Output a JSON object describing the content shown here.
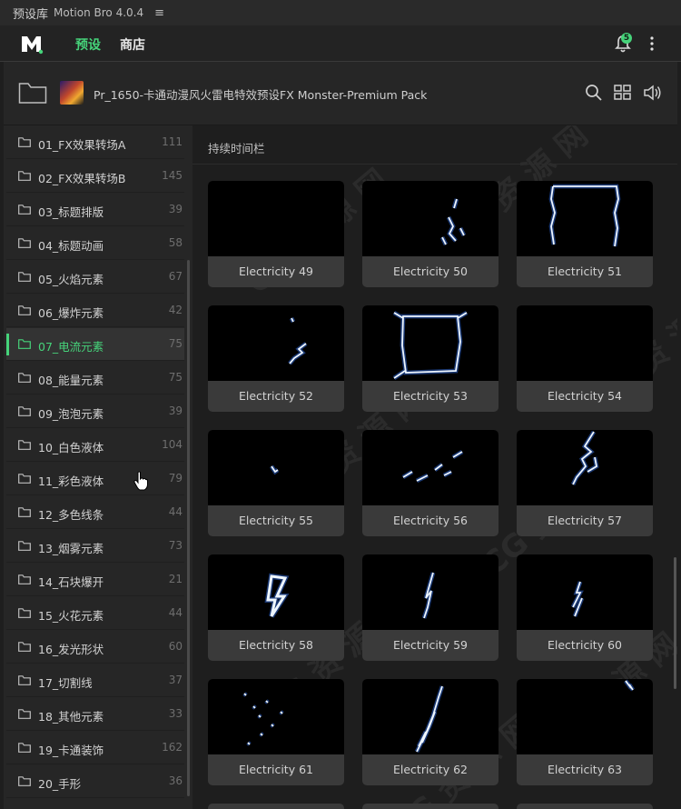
{
  "titlebar": {
    "title": "预设库",
    "app_name": "Motion Bro 4.0.4",
    "menu_glyph": "≡"
  },
  "nav": {
    "tabs": [
      {
        "label": "预设",
        "active": true
      },
      {
        "label": "商店",
        "active": false
      }
    ],
    "notification_count": "5",
    "accent_color": "#46d37a"
  },
  "pack": {
    "title": "Pr_1650-卡通动漫风火雷电特效预设FX Monster-Premium Pack",
    "icons": [
      "search-icon",
      "grid-view-icon",
      "volume-icon"
    ]
  },
  "categories": [
    {
      "label": "01_FX效果转场A",
      "count": "111",
      "active": false
    },
    {
      "label": "02_FX效果转场B",
      "count": "145",
      "active": false
    },
    {
      "label": "03_标题排版",
      "count": "39",
      "active": false
    },
    {
      "label": "04_标题动画",
      "count": "58",
      "active": false
    },
    {
      "label": "05_火焰元素",
      "count": "67",
      "active": false
    },
    {
      "label": "06_爆炸元素",
      "count": "42",
      "active": false
    },
    {
      "label": "07_电流元素",
      "count": "75",
      "active": true
    },
    {
      "label": "08_能量元素",
      "count": "75",
      "active": false
    },
    {
      "label": "09_泡泡元素",
      "count": "39",
      "active": false
    },
    {
      "label": "10_白色液体",
      "count": "104",
      "active": false
    },
    {
      "label": "11_彩色液体",
      "count": "79",
      "active": false
    },
    {
      "label": "12_多色线条",
      "count": "44",
      "active": false
    },
    {
      "label": "13_烟雾元素",
      "count": "73",
      "active": false
    },
    {
      "label": "14_石块爆开",
      "count": "21",
      "active": false
    },
    {
      "label": "15_火花元素",
      "count": "44",
      "active": false
    },
    {
      "label": "16_发光形状",
      "count": "60",
      "active": false
    },
    {
      "label": "17_切割线",
      "count": "37",
      "active": false
    },
    {
      "label": "18_其他元素",
      "count": "33",
      "active": false
    },
    {
      "label": "19_卡通装饰",
      "count": "162",
      "active": false
    },
    {
      "label": "20_手形",
      "count": "36",
      "active": false
    }
  ],
  "main": {
    "section_title": "持续时间栏",
    "presets": [
      {
        "label": "Electricity 49"
      },
      {
        "label": "Electricity 50"
      },
      {
        "label": "Electricity 51"
      },
      {
        "label": "Electricity 52"
      },
      {
        "label": "Electricity 53"
      },
      {
        "label": "Electricity 54"
      },
      {
        "label": "Electricity 55"
      },
      {
        "label": "Electricity 56"
      },
      {
        "label": "Electricity 57"
      },
      {
        "label": "Electricity 58"
      },
      {
        "label": "Electricity 59"
      },
      {
        "label": "Electricity 60"
      },
      {
        "label": "Electricity 61"
      },
      {
        "label": "Electricity 62"
      },
      {
        "label": "Electricity 63"
      }
    ]
  },
  "watermark": "CG 资 源 网"
}
